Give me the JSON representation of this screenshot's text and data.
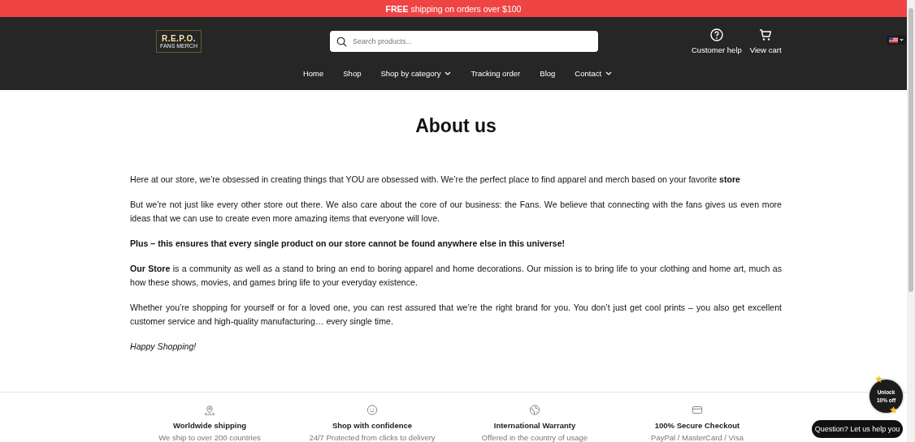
{
  "banner": {
    "text": "**FREE** shipping on orders over $100"
  },
  "header": {
    "logo": {
      "title": "R.E.P.O.",
      "subtitle": "FANS MERCH"
    },
    "search": {
      "placeholder": "Search products..."
    },
    "actions": [
      {
        "kind": "help",
        "label": "Customer help"
      },
      {
        "kind": "cart",
        "label": "View cart"
      }
    ]
  },
  "nav": [
    {
      "label": "Home",
      "has_menu": false
    },
    {
      "label": "Shop",
      "has_menu": false
    },
    {
      "label": "Shop by category",
      "has_menu": true
    },
    {
      "label": "Tracking order",
      "has_menu": false
    },
    {
      "label": "Blog",
      "has_menu": false
    },
    {
      "label": "Contact",
      "has_menu": true
    }
  ],
  "page": {
    "title": "About us",
    "paragraphs": [
      {
        "kind": "normal",
        "text": "Here at our store, we’re obsessed in creating things that YOU are obsessed with. We’re the perfect place to find apparel and merch based on your favorite **store**"
      },
      {
        "kind": "normal",
        "text": "But we’re not just like every other store out there. We also care about the core of our business: the Fans. We believe that connecting with the fans gives us even more ideas that we can use to create even more amazing items that everyone will love."
      },
      {
        "kind": "bold",
        "text": "Plus – this ensures that every single product on our store cannot be found anywhere else in this universe!"
      },
      {
        "kind": "normal",
        "text": "**Our Store** is a community as well as a stand to bring an end to boring apparel and home decorations. Our mission is to bring life to your clothing and home art, much as how these shows, movies, and games bring life to your everyday existence."
      },
      {
        "kind": "normal",
        "text": "Whether you’re shopping for yourself or for a loved one, you can rest assured that we’re the right brand for you. You don’t just get cool prints – you also get excellent customer service and high-quality manufacturing… every single time."
      },
      {
        "kind": "italic",
        "text": "Happy Shopping!"
      }
    ]
  },
  "features": [
    {
      "kind": "location",
      "title": "Worldwide shipping",
      "text": "We ship to over 200 countries"
    },
    {
      "kind": "smile",
      "title": "Shop with confidence",
      "text": "24/7 Protected from clicks to delivery"
    },
    {
      "kind": "globe",
      "title": "International Warranty",
      "text": "Offered in the country of usage"
    },
    {
      "kind": "card",
      "title": "100% Secure Checkout",
      "text": "PayPal / MasterCard / Visa"
    }
  ],
  "promo": {
    "line1": "Unlock",
    "line2": "10% off"
  },
  "chat": {
    "label": "Question? Let us help you"
  }
}
